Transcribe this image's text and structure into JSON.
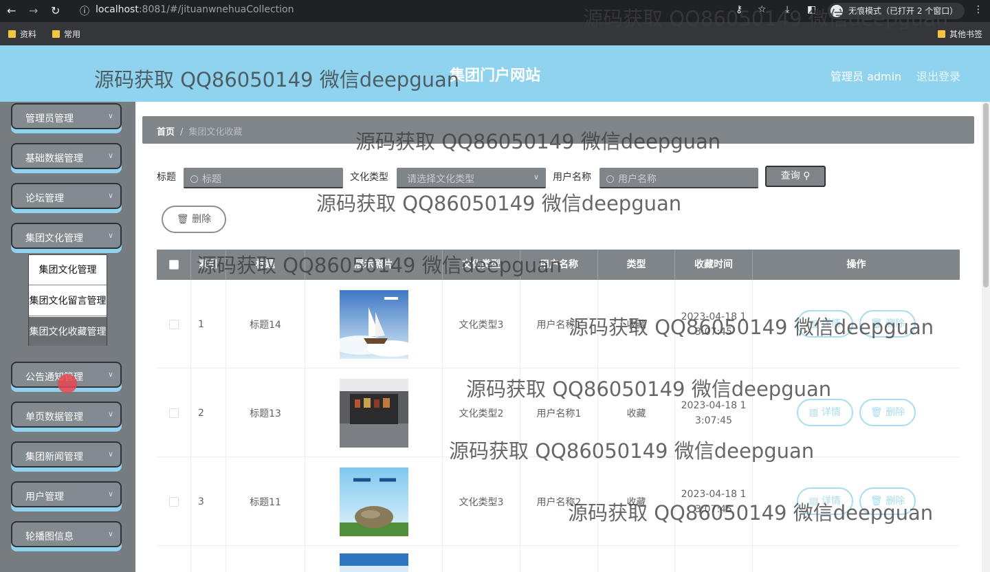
{
  "browser": {
    "url_host": "localhost",
    "url_rest": ":8081/#/jituanwnehuaCollection",
    "incognito_label": "无痕模式（已打开 2 个窗口）",
    "bookmarks": [
      "资料",
      "常用"
    ],
    "other_bookmarks": "其他书签"
  },
  "header": {
    "title": "集团门户网站",
    "user": "管理员 admin",
    "logout": "退出登录"
  },
  "sidebar": {
    "menus": [
      "管理员管理",
      "基础数据管理",
      "论坛管理",
      "集团文化管理",
      "公告通知管理",
      "单页数据管理",
      "集团新闻管理",
      "用户管理",
      "轮播图信息"
    ],
    "submenu": [
      "集团文化管理",
      "集团文化留言管理",
      "集团文化收藏管理"
    ],
    "active_sub_index": 2
  },
  "breadcrumb": {
    "home": "首页",
    "separator": "/",
    "current": "集团文化收藏"
  },
  "filters": {
    "title_label": "标题",
    "title_placeholder": "标题",
    "type_label": "文化类型",
    "type_placeholder": "请选择文化类型",
    "user_label": "用户名称",
    "user_placeholder": "用户名称",
    "query_button": "查询"
  },
  "actions": {
    "delete_button": "删除"
  },
  "table": {
    "columns": [
      "索引",
      "标题",
      "展示照片",
      "文化类型",
      "用户名称",
      "类型",
      "收藏时间",
      "操作"
    ],
    "rows": [
      {
        "index": "1",
        "title": "标题14",
        "type": "文化类型3",
        "user": "用户名称1",
        "kind": "收藏",
        "time1": "2023-04-18 1",
        "time2": "3:07:45",
        "detail": "详情",
        "delete": "删除"
      },
      {
        "index": "2",
        "title": "标题13",
        "type": "文化类型2",
        "user": "用户名称1",
        "kind": "收藏",
        "time1": "2023-04-18 1",
        "time2": "3:07:45",
        "detail": "详情",
        "delete": "删除"
      },
      {
        "index": "3",
        "title": "标题11",
        "type": "文化类型3",
        "user": "用户名称2",
        "kind": "收藏",
        "time1": "2023-04-18 1",
        "time2": "3:07:45",
        "detail": "详情",
        "delete": "删除"
      }
    ]
  },
  "watermark": "源码获取 QQ86050149 微信deepguan",
  "colors": {
    "header": "#8fd3ef",
    "sidebar": "#777c81",
    "accent": "#a8dcee"
  }
}
